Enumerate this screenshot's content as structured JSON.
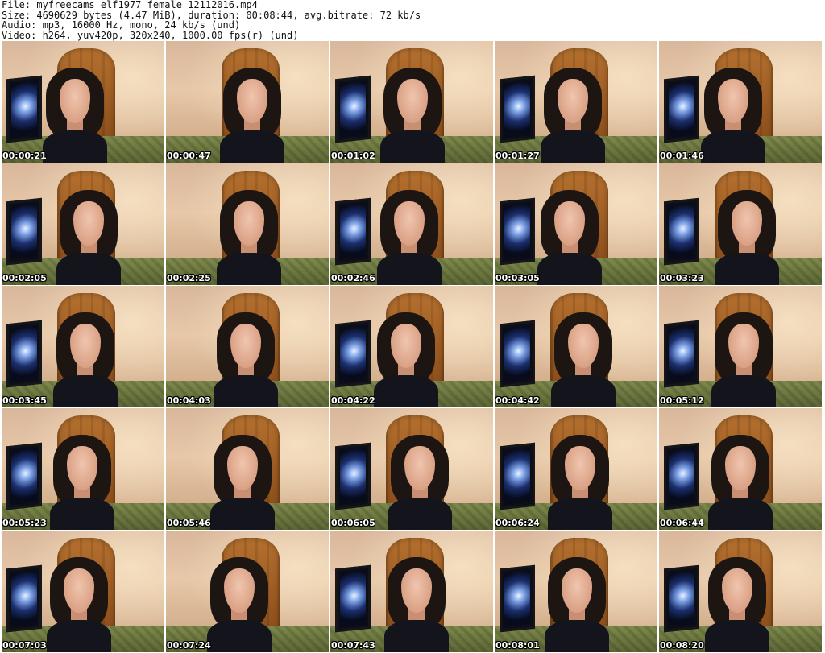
{
  "header": {
    "file_line": "File: myfreecams_elf1977_female_12112016.mp4",
    "size_line": "Size: 4690629 bytes (4.47 MiB), duration: 00:08:44, avg.bitrate: 72 kb/s",
    "audio_line": "Audio: mp3, 16000 Hz, mono, 24 kb/s (und)",
    "video_line": "Video: h264, yuv420p, 320x240, 1000.00 fps(r) (und)"
  },
  "frames": [
    {
      "timestamp": "00:00:21"
    },
    {
      "timestamp": "00:00:47"
    },
    {
      "timestamp": "00:01:02"
    },
    {
      "timestamp": "00:01:27"
    },
    {
      "timestamp": "00:01:46"
    },
    {
      "timestamp": "00:02:05"
    },
    {
      "timestamp": "00:02:25"
    },
    {
      "timestamp": "00:02:46"
    },
    {
      "timestamp": "00:03:05"
    },
    {
      "timestamp": "00:03:23"
    },
    {
      "timestamp": "00:03:45"
    },
    {
      "timestamp": "00:04:03"
    },
    {
      "timestamp": "00:04:22"
    },
    {
      "timestamp": "00:04:42"
    },
    {
      "timestamp": "00:05:12"
    },
    {
      "timestamp": "00:05:23"
    },
    {
      "timestamp": "00:05:46"
    },
    {
      "timestamp": "00:06:05"
    },
    {
      "timestamp": "00:06:24"
    },
    {
      "timestamp": "00:06:44"
    },
    {
      "timestamp": "00:07:03"
    },
    {
      "timestamp": "00:07:24"
    },
    {
      "timestamp": "00:07:43"
    },
    {
      "timestamp": "00:08:01"
    },
    {
      "timestamp": "00:08:20"
    }
  ]
}
